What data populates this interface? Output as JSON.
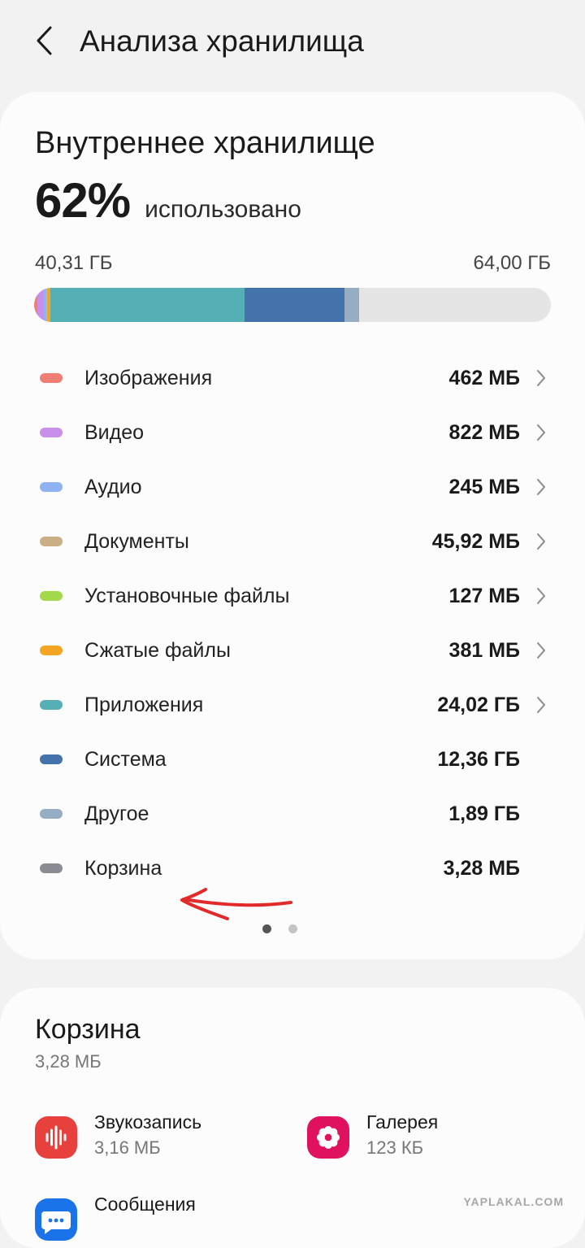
{
  "header": {
    "title": "Анализа хранилища",
    "back_icon": "chevron-left-icon"
  },
  "storage": {
    "title": "Внутреннее хранилище",
    "percent": "62%",
    "percent_label": "использовано",
    "used": "40,31 ГБ",
    "total": "64,00 ГБ",
    "used_fraction": 0.62
  },
  "categories": [
    {
      "label": "Изображения",
      "size": "462 МБ",
      "color": "#ef7f74",
      "has_chevron": true
    },
    {
      "label": "Видео",
      "size": "822 МБ",
      "color": "#c890ea",
      "has_chevron": true
    },
    {
      "label": "Аудио",
      "size": "245 МБ",
      "color": "#8fb3f2",
      "has_chevron": true
    },
    {
      "label": "Документы",
      "size": "45,92 МБ",
      "color": "#c9ae86",
      "has_chevron": true
    },
    {
      "label": "Установочные файлы",
      "size": "127 МБ",
      "color": "#a3d94a",
      "has_chevron": true
    },
    {
      "label": "Сжатые файлы",
      "size": "381 МБ",
      "color": "#f4a623",
      "has_chevron": true
    },
    {
      "label": "Приложения",
      "size": "24,02 ГБ",
      "color": "#55b0b5",
      "has_chevron": true
    },
    {
      "label": "Система",
      "size": "12,36 ГБ",
      "color": "#4472aa",
      "has_chevron": false
    },
    {
      "label": "Другое",
      "size": "1,89 ГБ",
      "color": "#96adc4",
      "has_chevron": false
    },
    {
      "label": "Корзина",
      "size": "3,28 МБ",
      "color": "#8c8c94",
      "has_chevron": false
    }
  ],
  "pager": {
    "count": 2,
    "active": 0
  },
  "trash": {
    "title": "Корзина",
    "size": "3,28 МБ",
    "apps": [
      {
        "name": "Звукозапись",
        "size": "3,16 МБ",
        "icon": "voice-recorder-icon",
        "color": "#e8403d"
      },
      {
        "name": "Галерея",
        "size": "123 КБ",
        "icon": "gallery-flower-icon",
        "color": "#e0115f"
      },
      {
        "name": "Сообщения",
        "size": "",
        "icon": "messages-icon",
        "color": "#1a73e8"
      }
    ]
  },
  "watermark": "YAPLAKAL.COM"
}
